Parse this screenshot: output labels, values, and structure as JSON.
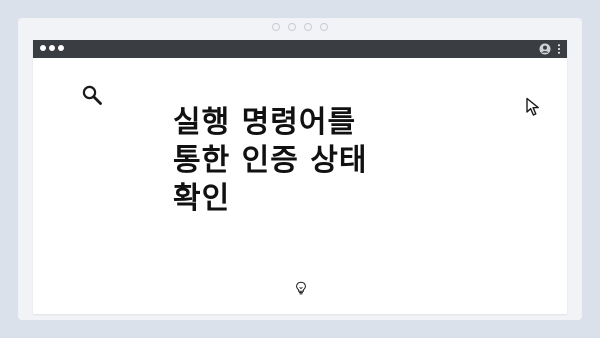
{
  "headline": {
    "lines": [
      "실행 명령어를",
      "통한 인증 상태",
      "확인"
    ]
  },
  "icons": {
    "search": "search-icon",
    "cursor": "cursor-icon",
    "lightbulb": "lightbulb-icon",
    "user": "user-icon",
    "menu": "kebab-menu-icon"
  },
  "colors": {
    "background": "#dbe1ea",
    "frame": "#f1f3f6",
    "titlebar": "#3a3d42",
    "window": "#ffffff",
    "text": "#111111"
  }
}
